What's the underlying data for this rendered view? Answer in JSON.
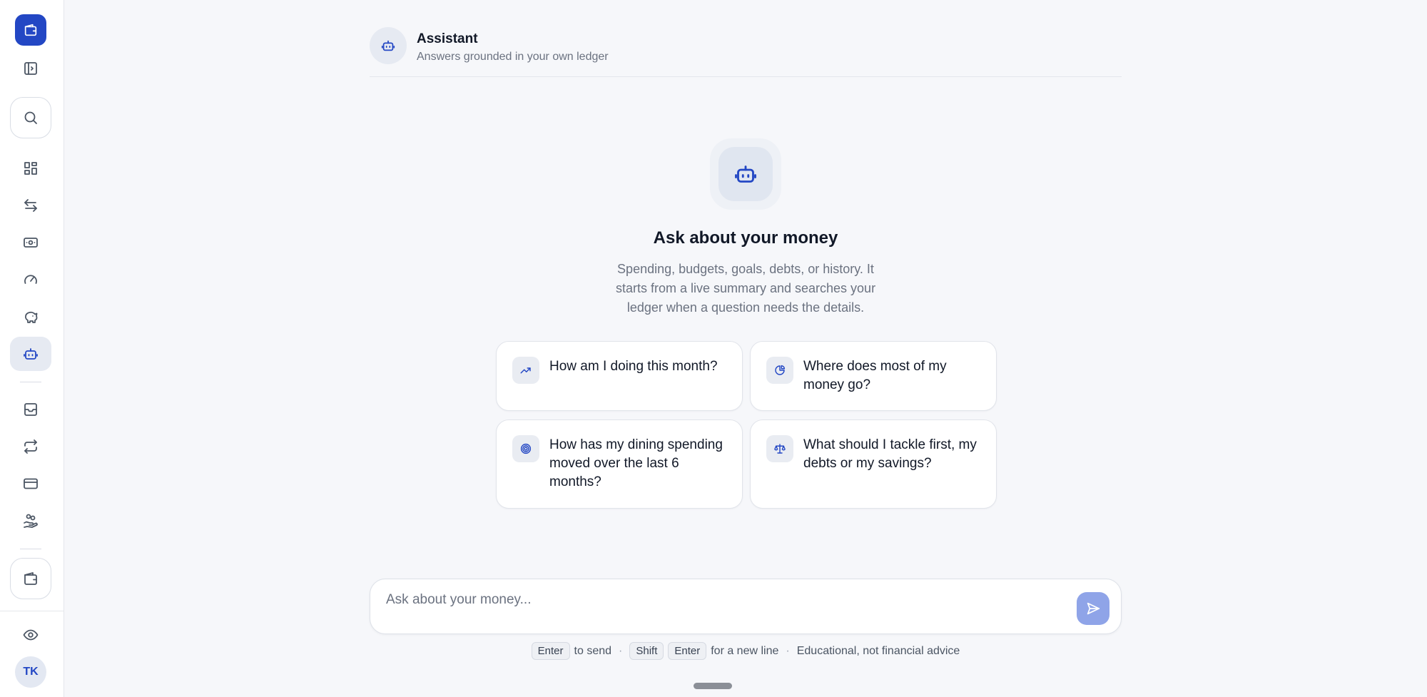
{
  "sidebar": {
    "logo_icon": "wallet-icon",
    "items": [
      {
        "name": "toggle-sidebar",
        "icon": "panel-toggle-icon"
      },
      {
        "name": "search",
        "icon": "search-icon"
      },
      {
        "name": "dashboard",
        "icon": "grid-icon"
      },
      {
        "name": "transactions",
        "icon": "arrows-left-right-icon"
      },
      {
        "name": "cash",
        "icon": "banknote-icon"
      },
      {
        "name": "budgets",
        "icon": "gauge-icon"
      },
      {
        "name": "savings",
        "icon": "piggy-bank-icon"
      },
      {
        "name": "assistant",
        "icon": "bot-icon",
        "active": true
      },
      {
        "name": "inbox",
        "icon": "archive-icon"
      },
      {
        "name": "recurring",
        "icon": "repeat-icon"
      },
      {
        "name": "cards",
        "icon": "credit-card-icon"
      },
      {
        "name": "debts",
        "icon": "hand-coins-icon"
      },
      {
        "name": "accounts",
        "icon": "wallet-icon"
      },
      {
        "name": "privacy",
        "icon": "eye-icon"
      }
    ],
    "avatar_initials": "TK"
  },
  "header": {
    "title": "Assistant",
    "subtitle": "Answers grounded in your own ledger"
  },
  "hero": {
    "title": "Ask about your money",
    "description": "Spending, budgets, goals, debts, or history. It starts from a live summary and searches your ledger when a question needs the details."
  },
  "suggestions": [
    {
      "icon": "trending-up-icon",
      "text": "How am I doing this month?"
    },
    {
      "icon": "pie-chart-icon",
      "text": "Where does most of my money go?"
    },
    {
      "icon": "target-icon",
      "text": "How has my dining spending moved over the last 6 months?"
    },
    {
      "icon": "scale-icon",
      "text": "What should I tackle first, my debts or my savings?"
    }
  ],
  "composer": {
    "placeholder": "Ask about your money...",
    "value": ""
  },
  "hint": {
    "key_enter": "Enter",
    "to_send": "to send",
    "key_shift": "Shift",
    "key_enter2": "Enter",
    "new_line": "for a new line",
    "sep": "·",
    "disclaimer": "Educational, not financial advice"
  },
  "colors": {
    "accent": "#2347c4",
    "send_button": "#8fa4e8",
    "background": "#f6f7fa"
  }
}
